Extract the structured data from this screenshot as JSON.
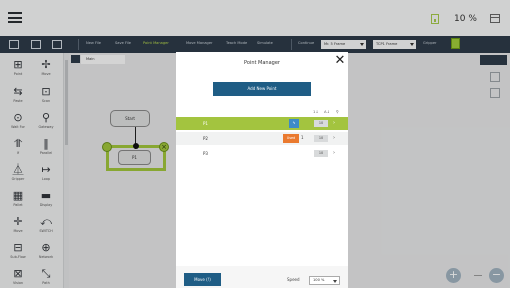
{
  "topbar": {
    "battery_text": "10 %",
    "menu_icon": "hamburger-icon",
    "battery_icon": "battery-icon",
    "window_icon": "window-icon"
  },
  "toolbar": {
    "items": [
      "New File",
      "Save File",
      "Point Manager",
      "Move Manager",
      "Teach Mode",
      "Simulate"
    ],
    "active_item": "Point Manager",
    "mode_label": "Continue",
    "frame_select": "Mr. 5 Frame",
    "tool_select": "TCP1 Frame",
    "gripper_label": "Gripper",
    "accent_color": "#b7d84c"
  },
  "palette": {
    "items": [
      {
        "label": "Point",
        "icon": "point-icon",
        "glyph": "⊞"
      },
      {
        "label": "Move",
        "icon": "move-icon",
        "glyph": "✢"
      },
      {
        "label": "Paste",
        "icon": "paste-icon",
        "glyph": "⇆"
      },
      {
        "label": "Scan",
        "icon": "scan-icon",
        "glyph": "⊡"
      },
      {
        "label": "Wait For",
        "icon": "wait-icon",
        "glyph": "⊙"
      },
      {
        "label": "Gateway",
        "icon": "gateway-icon",
        "glyph": "⚲"
      },
      {
        "label": "If",
        "icon": "if-icon",
        "glyph": "⥣"
      },
      {
        "label": "Parallel",
        "icon": "parallel-icon",
        "glyph": "‖"
      },
      {
        "label": "Gripper",
        "icon": "gripper-icon",
        "glyph": "⏅"
      },
      {
        "label": "Loop",
        "icon": "loop-icon",
        "glyph": "↦"
      },
      {
        "label": "Pallet",
        "icon": "pallet-icon",
        "glyph": "▦"
      },
      {
        "label": "Display",
        "icon": "display-icon",
        "glyph": "▬"
      },
      {
        "label": "Move",
        "icon": "axis-icon",
        "glyph": "✛"
      },
      {
        "label": "SWITCH",
        "icon": "switch-icon",
        "glyph": "⤺"
      },
      {
        "label": "Sub-Flow",
        "icon": "subflow-icon",
        "glyph": "⊟"
      },
      {
        "label": "Network",
        "icon": "network-icon",
        "glyph": "⊕"
      },
      {
        "label": "Vision",
        "icon": "vision-icon",
        "glyph": "⊠"
      },
      {
        "label": "Path",
        "icon": "path-icon",
        "glyph": "⤡"
      }
    ]
  },
  "canvas": {
    "tab_label": "Main",
    "node_start": "Start",
    "node_p1": "P1",
    "frame_color": "#9fc33b"
  },
  "dialog": {
    "title": "Point Manager",
    "add_button": "Add New Point",
    "sort_labels": [
      "1↓",
      "A↓",
      "⚲"
    ],
    "rows": [
      {
        "name": "P1",
        "selected": true,
        "badge": "",
        "num": "",
        "speed": "10"
      },
      {
        "name": "P2",
        "selected": false,
        "badge": "Used",
        "num": "1",
        "speed": "10"
      },
      {
        "name": "P3",
        "selected": false,
        "badge": "",
        "num": "",
        "speed": "10"
      }
    ],
    "move_button": "Move (!)",
    "speed_label": "Speed",
    "speed_value": "100 %",
    "close_icon": "close-icon"
  },
  "colors": {
    "dark_bar": "#2d3a48",
    "primary_button": "#1f5d85",
    "selected_row": "#a3c43f",
    "badge_blue": "#3d8ac6",
    "badge_orange": "#ea7a2f"
  }
}
